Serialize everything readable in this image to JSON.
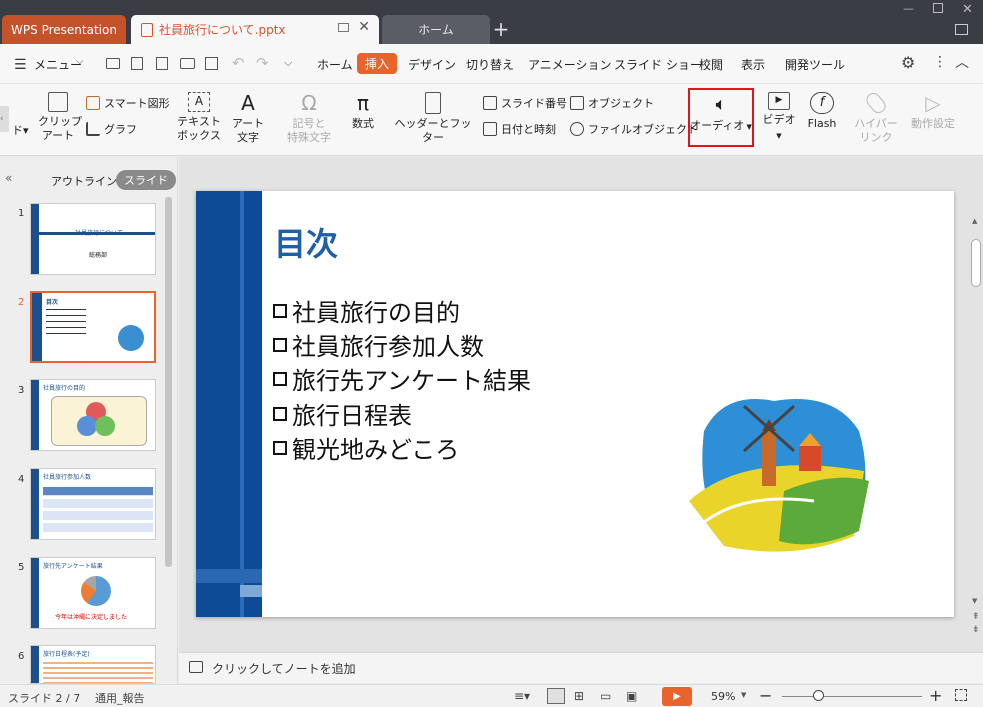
{
  "tabs": {
    "wps": "WPS Presentation",
    "file": "社員旅行について.pptx",
    "home": "ホーム",
    "plus": "+"
  },
  "menubar": {
    "menu_label": "メニュー",
    "tabs": [
      "ホーム",
      "挿入",
      "デザイン",
      "切り替え",
      "アニメーション",
      "スライド ショー",
      "校閲",
      "表示",
      "開発ツール"
    ],
    "active_tab": "挿入"
  },
  "ribbon": {
    "clip_art": "クリップ\nアート",
    "smart_shape": "スマート図形",
    "graph": "グラフ",
    "textbox": "テキスト\nボックス",
    "art_text": "アート\n文字",
    "symbol": "記号と\n特殊文字",
    "formula": "数式",
    "header_footer": "ヘッダーとフッター",
    "slide_number": "スライド番号",
    "datetime": "日付と時刻",
    "object": "オブジェクト",
    "file_object": "ファイルオブジェクト",
    "audio": "オーディオ",
    "video": "ビデオ",
    "flash": "Flash",
    "hyperlink": "ハイパー\nリンク",
    "action": "動作設定",
    "highlight_color": "#e0161d"
  },
  "sidepanel": {
    "outline_tab": "アウトライン",
    "slide_tab": "スライド",
    "thumbnails": [
      {
        "num": "1",
        "title": "社員旅行について",
        "sub": "総務部"
      },
      {
        "num": "2",
        "title": "目次"
      },
      {
        "num": "3",
        "title": "社員旅行の目的"
      },
      {
        "num": "4",
        "title": "社員旅行参加人数"
      },
      {
        "num": "5",
        "title": "旅行先アンケート結果",
        "note": "今年は沖縄に決定しました"
      },
      {
        "num": "6",
        "title": "旅行日程表(予定)"
      }
    ]
  },
  "slide": {
    "title": "目次",
    "bullets": [
      "社員旅行の目的",
      "社員旅行参加人数",
      "旅行先アンケート結果",
      "旅行日程表",
      "観光地みどころ"
    ]
  },
  "notes": {
    "placeholder": "クリックしてノートを追加"
  },
  "status": {
    "slide_counter": "スライド 2 / 7",
    "template": "通用_報告",
    "zoom": "59%"
  }
}
